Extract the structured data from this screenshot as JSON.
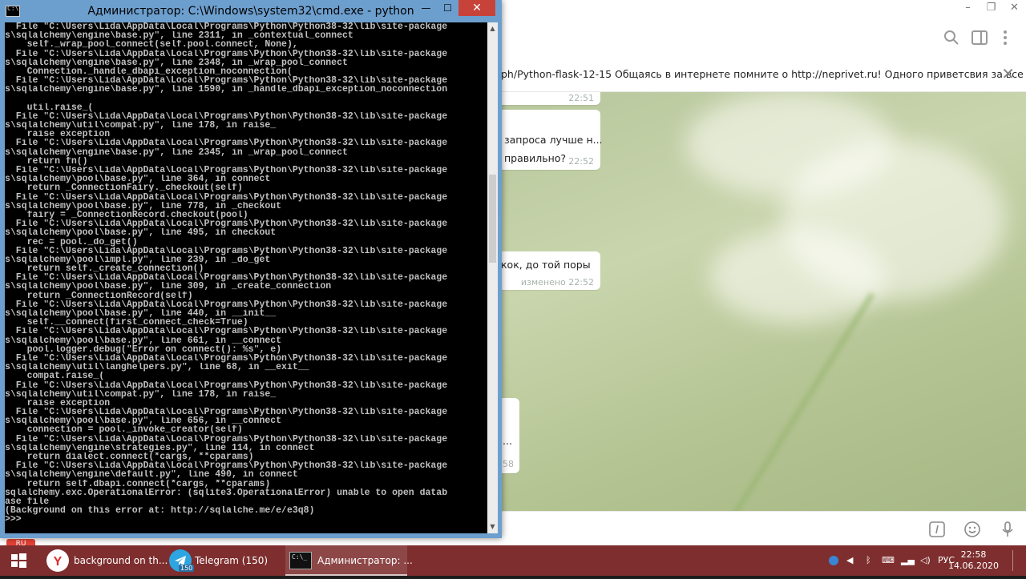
{
  "telegram": {
    "pinned_text": "ph/Python-flask-12-15  Общаясь в интернете помните о http://neprivet.ru! Одного приветсвия за все з...",
    "messages": [
      {
        "text": "",
        "time": "22:51"
      },
      {
        "text": "запроса лучше н...",
        "text2": "правильно?",
        "time": "22:52"
      },
      {
        "text": "кок, до той поры",
        "time": "изменено 22:52"
      },
      {
        "text": "...",
        "time": "58"
      }
    ],
    "badge": "RU"
  },
  "cmd": {
    "title": "Администратор: C:\\Windows\\system32\\cmd.exe - python",
    "lines": [
      "  File \"C:\\Users\\Lida\\AppData\\Local\\Programs\\Python\\Python38-32\\lib\\site-package",
      "s\\sqlalchemy\\engine\\base.py\", line 2311, in _contextual_connect",
      "    self._wrap_pool_connect(self.pool.connect, None),",
      "  File \"C:\\Users\\Lida\\AppData\\Local\\Programs\\Python\\Python38-32\\lib\\site-package",
      "s\\sqlalchemy\\engine\\base.py\", line 2348, in _wrap_pool_connect",
      "    Connection._handle_dbapi_exception_noconnection(",
      "  File \"C:\\Users\\Lida\\AppData\\Local\\Programs\\Python\\Python38-32\\lib\\site-package",
      "s\\sqlalchemy\\engine\\base.py\", line 1590, in _handle_dbapi_exception_noconnection",
      "",
      "    util.raise_(",
      "  File \"C:\\Users\\Lida\\AppData\\Local\\Programs\\Python\\Python38-32\\lib\\site-package",
      "s\\sqlalchemy\\util\\compat.py\", line 178, in raise_",
      "    raise exception",
      "  File \"C:\\Users\\Lida\\AppData\\Local\\Programs\\Python\\Python38-32\\lib\\site-package",
      "s\\sqlalchemy\\engine\\base.py\", line 2345, in _wrap_pool_connect",
      "    return fn()",
      "  File \"C:\\Users\\Lida\\AppData\\Local\\Programs\\Python\\Python38-32\\lib\\site-package",
      "s\\sqlalchemy\\pool\\base.py\", line 364, in connect",
      "    return _ConnectionFairy._checkout(self)",
      "  File \"C:\\Users\\Lida\\AppData\\Local\\Programs\\Python\\Python38-32\\lib\\site-package",
      "s\\sqlalchemy\\pool\\base.py\", line 778, in _checkout",
      "    fairy = _ConnectionRecord.checkout(pool)",
      "  File \"C:\\Users\\Lida\\AppData\\Local\\Programs\\Python\\Python38-32\\lib\\site-package",
      "s\\sqlalchemy\\pool\\base.py\", line 495, in checkout",
      "    rec = pool._do_get()",
      "  File \"C:\\Users\\Lida\\AppData\\Local\\Programs\\Python\\Python38-32\\lib\\site-package",
      "s\\sqlalchemy\\pool\\impl.py\", line 239, in _do_get",
      "    return self._create_connection()",
      "  File \"C:\\Users\\Lida\\AppData\\Local\\Programs\\Python\\Python38-32\\lib\\site-package",
      "s\\sqlalchemy\\pool\\base.py\", line 309, in _create_connection",
      "    return _ConnectionRecord(self)",
      "  File \"C:\\Users\\Lida\\AppData\\Local\\Programs\\Python\\Python38-32\\lib\\site-package",
      "s\\sqlalchemy\\pool\\base.py\", line 440, in __init__",
      "    self.__connect(first_connect_check=True)",
      "  File \"C:\\Users\\Lida\\AppData\\Local\\Programs\\Python\\Python38-32\\lib\\site-package",
      "s\\sqlalchemy\\pool\\base.py\", line 661, in __connect",
      "    pool.logger.debug(\"Error on connect(): %s\", e)",
      "  File \"C:\\Users\\Lida\\AppData\\Local\\Programs\\Python\\Python38-32\\lib\\site-package",
      "s\\sqlalchemy\\util\\langhelpers.py\", line 68, in __exit__",
      "    compat.raise_(",
      "  File \"C:\\Users\\Lida\\AppData\\Local\\Programs\\Python\\Python38-32\\lib\\site-package",
      "s\\sqlalchemy\\util\\compat.py\", line 178, in raise_",
      "    raise exception",
      "  File \"C:\\Users\\Lida\\AppData\\Local\\Programs\\Python\\Python38-32\\lib\\site-package",
      "s\\sqlalchemy\\pool\\base.py\", line 656, in __connect",
      "    connection = pool._invoke_creator(self)",
      "  File \"C:\\Users\\Lida\\AppData\\Local\\Programs\\Python\\Python38-32\\lib\\site-package",
      "s\\sqlalchemy\\engine\\strategies.py\", line 114, in connect",
      "    return dialect.connect(*cargs, **cparams)",
      "  File \"C:\\Users\\Lida\\AppData\\Local\\Programs\\Python\\Python38-32\\lib\\site-package",
      "s\\sqlalchemy\\engine\\default.py\", line 490, in connect",
      "    return self.dbapi.connect(*cargs, **cparams)",
      "sqlalchemy.exc.OperationalError: (sqlite3.OperationalError) unable to open datab",
      "ase file",
      "(Background on this error at: http://sqlalche.me/e/e3q8)",
      ">>>"
    ]
  },
  "taskbar": {
    "tasks": [
      {
        "label": "background on th...",
        "icon": "yandex-browser-icon",
        "color": "#e32b2b"
      },
      {
        "label": "Telegram (150)",
        "icon": "telegram-icon",
        "color": "#2ca5e0",
        "badge": "150"
      },
      {
        "label": "Администратор: ...",
        "icon": "cmd-icon",
        "color": "#111111"
      }
    ],
    "lang": "РУС",
    "time": "22:58",
    "date": "14.06.2020"
  }
}
